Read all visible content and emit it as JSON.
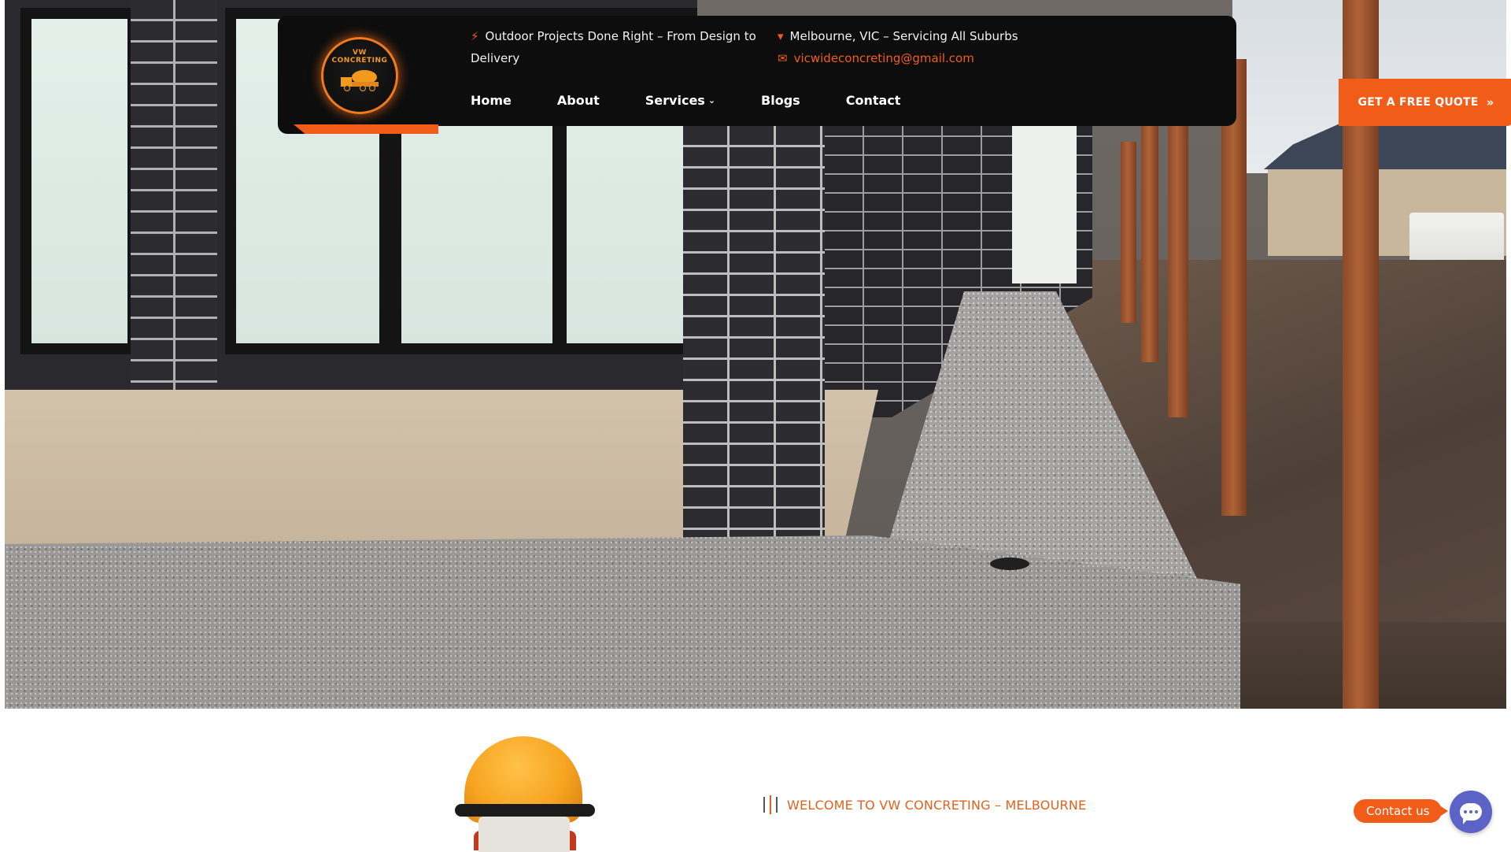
{
  "header": {
    "logo": {
      "alt_text": "VW CONCRETING",
      "icon": "cement-mixer-truck-icon"
    },
    "info": {
      "tagline": "Outdoor Projects Done Right – From Design to Delivery",
      "tagline_icon": "bolt-icon",
      "location": "Melbourne, VIC – Servicing All Suburbs",
      "location_icon": "map-pin-icon",
      "email": "vicwideconcreting@gmail.com",
      "email_icon": "envelope-icon"
    },
    "nav": {
      "items": [
        {
          "label": "Home"
        },
        {
          "label": "About"
        },
        {
          "label": "Services",
          "has_dropdown": true
        },
        {
          "label": "Blogs"
        },
        {
          "label": "Contact"
        }
      ]
    },
    "cta": {
      "label": "GET A FREE QUOTE",
      "icon": "double-chevron-right-icon"
    }
  },
  "hero": {
    "image_subject": "exposed-aggregate-concrete-path"
  },
  "section": {
    "eyebrow": "WELCOME TO VW CONCRETING – MELBOURNE",
    "eyebrow_icon": "lines-icon"
  },
  "chat_widget": {
    "label": "Contact us",
    "icon": "chat-bubble-icon"
  },
  "colors": {
    "accent": "#f25c19",
    "header_bg": "#0d0d0d",
    "chat_fab": "#5b63c6"
  }
}
